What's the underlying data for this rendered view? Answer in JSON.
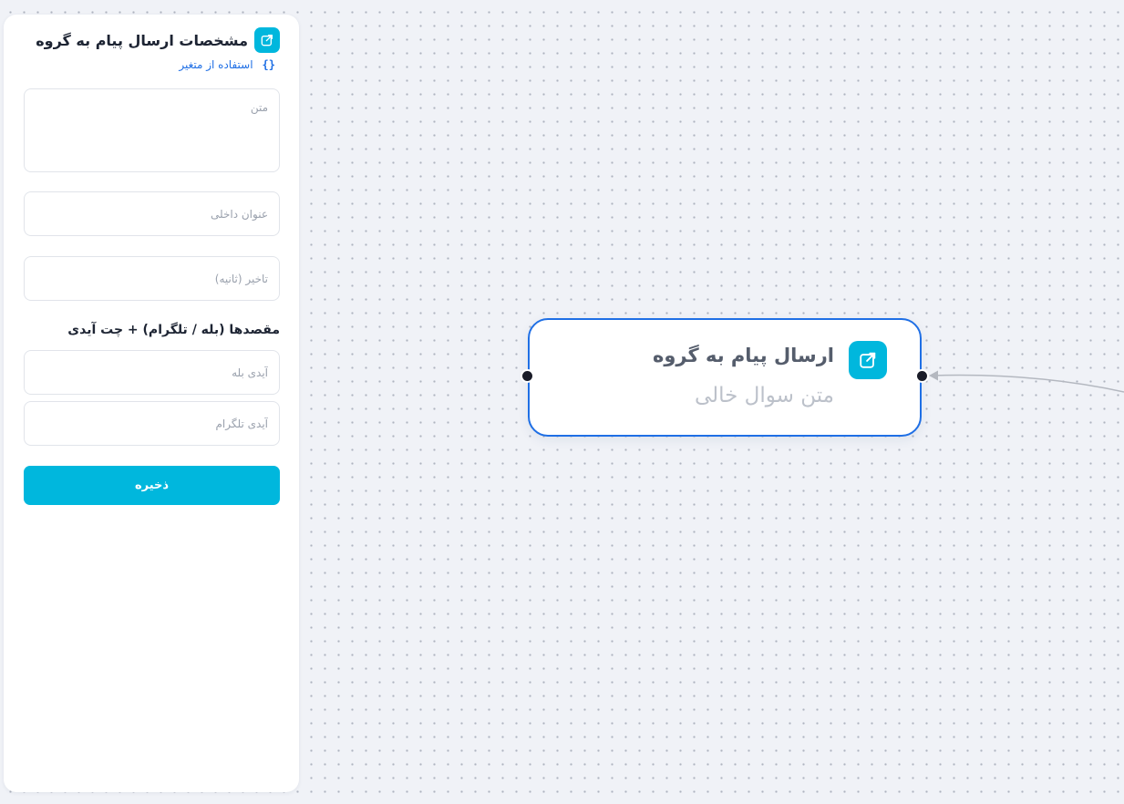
{
  "panel": {
    "title": "مشخصات ارسال پیام به گروه",
    "title_icon": "share-icon",
    "variable_braces": "{}",
    "variable_label": "استفاده از متغیر",
    "text_placeholder": "متن",
    "internal_title_placeholder": "عنوان داخلی",
    "delay_placeholder": "تاخیر (ثانیه)",
    "destinations_heading": "مقصدها (بله / تلگرام) + چت آیدی",
    "bale_id_placeholder": "آیدی بله",
    "telegram_id_placeholder": "آیدی تلگرام",
    "save_label": "ذخیره"
  },
  "node": {
    "title": "ارسال پیام به گروه",
    "subtitle": "متن سوال خالی",
    "icon": "share-icon"
  },
  "colors": {
    "accent": "#00b7dd",
    "node_border": "#1f6fe5",
    "link": "#1f6fe5",
    "canvas_background": "#f0f2f7",
    "handle": "#1a1c28"
  }
}
